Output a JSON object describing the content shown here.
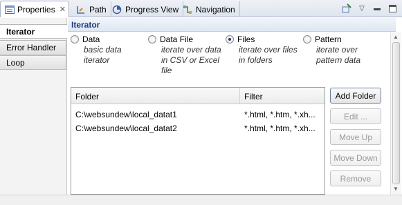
{
  "tabs": [
    {
      "label": "Properties",
      "icon": "properties-icon",
      "active": true
    },
    {
      "label": "Path",
      "icon": "path-icon"
    },
    {
      "label": "Progress View",
      "icon": "progress-view-icon"
    },
    {
      "label": "Navigation",
      "icon": "navigation-icon"
    }
  ],
  "sidebar": {
    "items": [
      {
        "label": "Iterator",
        "active": true
      },
      {
        "label": "Error Handler"
      },
      {
        "label": "Loop"
      }
    ]
  },
  "section": {
    "title": "Iterator"
  },
  "options": [
    {
      "label": "Data",
      "desc": [
        "basic data",
        "iterator"
      ],
      "checked": false
    },
    {
      "label": "Data File",
      "desc": [
        "iterate over data",
        "in CSV or Excel",
        "file"
      ],
      "checked": false
    },
    {
      "label": "Files",
      "desc": [
        "iterate over files",
        "in folders"
      ],
      "checked": true
    },
    {
      "label": "Pattern",
      "desc": [
        "iterate over",
        "pattern data"
      ],
      "checked": false
    }
  ],
  "table": {
    "headers": {
      "folder": "Folder",
      "filter": "Filter"
    },
    "rows": [
      {
        "folder": "C:\\websundew\\local_datat1",
        "filter": "*.html, *.htm, *.xh..."
      },
      {
        "folder": "C:\\websundew\\local_datat2",
        "filter": "*.html, *.htm, *.xh..."
      }
    ]
  },
  "buttons": {
    "add_folder": "Add Folder",
    "edit": "Edit ...",
    "move_up": "Move Up",
    "move_down": "Move Down",
    "remove": "Remove"
  },
  "colors": {
    "section_title": "#1f3a78",
    "radio_dot": "#203a80"
  }
}
